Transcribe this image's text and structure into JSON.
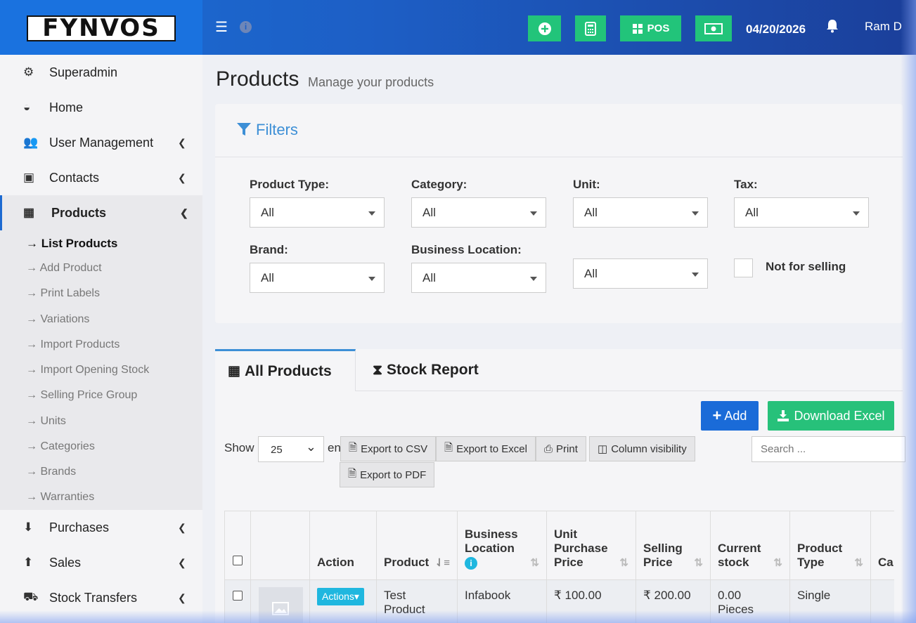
{
  "brand": {
    "logo_text": "FYNVOS"
  },
  "topbar": {
    "menu_icon": "hamburger-icon",
    "pos_label": "POS",
    "date": "04/20/2026",
    "user": "Ram D"
  },
  "sidebar": {
    "items": [
      {
        "label": "Superadmin",
        "icon": "user-gear-icon"
      },
      {
        "label": "Home",
        "icon": "dashboard-icon"
      },
      {
        "label": "User Management",
        "icon": "users-icon"
      },
      {
        "label": "Contacts",
        "icon": "address-book-icon"
      },
      {
        "label": "Products",
        "icon": "cubes-icon"
      },
      {
        "label": "Purchases",
        "icon": "arrow-circle-down-icon"
      },
      {
        "label": "Sales",
        "icon": "arrow-circle-up-icon"
      },
      {
        "label": "Stock Transfers",
        "icon": "truck-icon"
      }
    ],
    "submenu": [
      "→ List Products",
      "→ Add Product",
      "→ Print Labels",
      "→ Variations",
      "→ Import Products",
      "→ Import Opening Stock",
      "→ Selling Price Group",
      "→ Units",
      "→ Categories",
      "→ Brands",
      "→ Warranties"
    ]
  },
  "page": {
    "title": "Products",
    "subtitle": "Manage your products"
  },
  "filters": {
    "title": "Filters",
    "product_type": {
      "label": "Product Type:",
      "value": "All"
    },
    "category": {
      "label": "Category:",
      "value": "All"
    },
    "unit": {
      "label": "Unit:",
      "value": "All"
    },
    "tax": {
      "label": "Tax:",
      "value": "All"
    },
    "brand": {
      "label": "Brand:",
      "value": "All"
    },
    "business_location": {
      "label": "Business Location:",
      "value": "All"
    },
    "extra": {
      "value": "All"
    },
    "not_for_selling": "Not for selling"
  },
  "tabs": [
    {
      "label": "All Products",
      "icon": "cubes-icon"
    },
    {
      "label": "Stock Report",
      "icon": "hourglass-icon"
    }
  ],
  "toolbar": {
    "add_label": "Add",
    "download_label": "Download Excel",
    "show_label": "Show",
    "show_value": "25",
    "entries_label": "en",
    "export_csv": "Export to CSV",
    "export_excel": "Export to Excel",
    "print": "Print",
    "column_visibility": "Column visibility",
    "export_pdf": "Export to PDF",
    "search_placeholder": "Search ..."
  },
  "table": {
    "headers": [
      "Action",
      "Product",
      "Business Location",
      "Unit Purchase Price",
      "Selling Price",
      "Current stock",
      "Product Type",
      "Ca"
    ],
    "rows": [
      {
        "action": "Actions",
        "product": "Test Product",
        "location": "Infabook",
        "purchase_price": "₹ 100.00",
        "selling_price": "₹ 200.00",
        "stock": "0.00 Pieces",
        "type": "Single"
      }
    ]
  },
  "colors": {
    "primary": "#1a6bd8",
    "success": "#27c17a",
    "info": "#1fb7df",
    "link": "#3d8fd6"
  }
}
